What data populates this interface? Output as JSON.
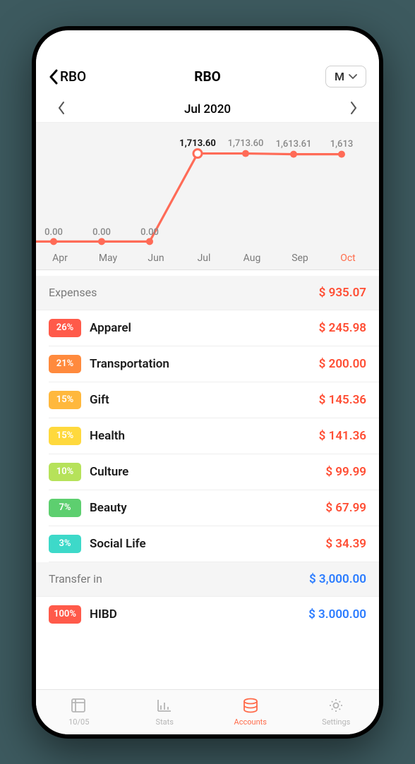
{
  "header": {
    "back_label": "RBO",
    "title": "RBO",
    "period_label": "M"
  },
  "month_nav": {
    "label": "Jul 2020"
  },
  "chart_data": {
    "type": "line",
    "categories": [
      "Apr",
      "May",
      "Jun",
      "Jul",
      "Aug",
      "Sep",
      "Oct"
    ],
    "values": [
      0.0,
      0.0,
      0.0,
      1713.6,
      1713.6,
      1613.61,
      1613
    ],
    "selected_index": 3,
    "labels": [
      "0.00",
      "0.00",
      "0.00",
      "1,713.60",
      "1,713.60",
      "1,613.61",
      "1,613"
    ],
    "color": "#ff6b57"
  },
  "sections": [
    {
      "name": "Expenses",
      "total": "$ 935.07",
      "total_color": "red",
      "rows": [
        {
          "pct": "26%",
          "pct_color": "#ff5a4a",
          "label": "Apparel",
          "amount": "$ 245.98",
          "amt_color": "red"
        },
        {
          "pct": "21%",
          "pct_color": "#ff8a3d",
          "label": "Transportation",
          "amount": "$ 200.00",
          "amt_color": "red"
        },
        {
          "pct": "15%",
          "pct_color": "#ffb83d",
          "label": "Gift",
          "amount": "$ 145.36",
          "amt_color": "red"
        },
        {
          "pct": "15%",
          "pct_color": "#ffd93d",
          "label": "Health",
          "amount": "$ 141.36",
          "amt_color": "red"
        },
        {
          "pct": "10%",
          "pct_color": "#b6e25a",
          "label": "Culture",
          "amount": "$ 99.99",
          "amt_color": "red"
        },
        {
          "pct": "7%",
          "pct_color": "#5dcf6f",
          "label": "Beauty",
          "amount": "$ 67.99",
          "amt_color": "red"
        },
        {
          "pct": "3%",
          "pct_color": "#3dd9c9",
          "label": "Social Life",
          "amount": "$ 34.39",
          "amt_color": "red"
        }
      ]
    },
    {
      "name": "Transfer in",
      "total": "$ 3,000.00",
      "total_color": "blue",
      "rows": [
        {
          "pct": "100%",
          "pct_color": "#ff5a4a",
          "label": "HIBD",
          "amount": "$ 3.000.00",
          "amt_color": "blue"
        }
      ]
    }
  ],
  "tabbar": {
    "tabs": [
      {
        "label": "10/05"
      },
      {
        "label": "Stats"
      },
      {
        "label": "Accounts"
      },
      {
        "label": "Settings"
      }
    ],
    "active_index": 2
  }
}
